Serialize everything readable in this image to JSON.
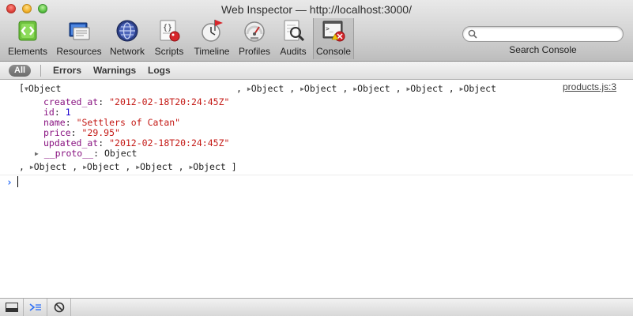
{
  "window": {
    "title": "Web Inspector — http://localhost:3000/"
  },
  "toolbar": {
    "tools": [
      {
        "label": "Elements",
        "icon": "elements-icon"
      },
      {
        "label": "Resources",
        "icon": "resources-icon"
      },
      {
        "label": "Network",
        "icon": "network-icon"
      },
      {
        "label": "Scripts",
        "icon": "scripts-icon"
      },
      {
        "label": "Timeline",
        "icon": "timeline-icon"
      },
      {
        "label": "Profiles",
        "icon": "profiles-icon"
      },
      {
        "label": "Audits",
        "icon": "audits-icon"
      },
      {
        "label": "Console",
        "icon": "console-icon",
        "active": true
      }
    ],
    "search": {
      "placeholder": "",
      "value": "",
      "label": "Search Console"
    }
  },
  "filters": {
    "all": "All",
    "errors": "Errors",
    "warnings": "Warnings",
    "logs": "Logs"
  },
  "console": {
    "source": "products.js:3",
    "open_bracket": "[",
    "close_bracket": "]",
    "comma": ",",
    "object_label": "Object",
    "properties": [
      {
        "name": "created_at",
        "value": "\"2012-02-18T20:24:45Z\"",
        "kind": "string"
      },
      {
        "name": "id",
        "value": "1",
        "kind": "number"
      },
      {
        "name": "name",
        "value": "\"Settlers of Catan\"",
        "kind": "string"
      },
      {
        "name": "price",
        "value": "\"29.95\"",
        "kind": "string"
      },
      {
        "name": "updated_at",
        "value": "\"2012-02-18T20:24:45Z\"",
        "kind": "string"
      }
    ],
    "proto": {
      "name": "__proto__",
      "value": "Object"
    },
    "prompt_value": ""
  },
  "colors": {
    "property": "#881280",
    "string": "#c41a16",
    "number": "#1c00cf",
    "prompt": "#2d6ff7"
  }
}
